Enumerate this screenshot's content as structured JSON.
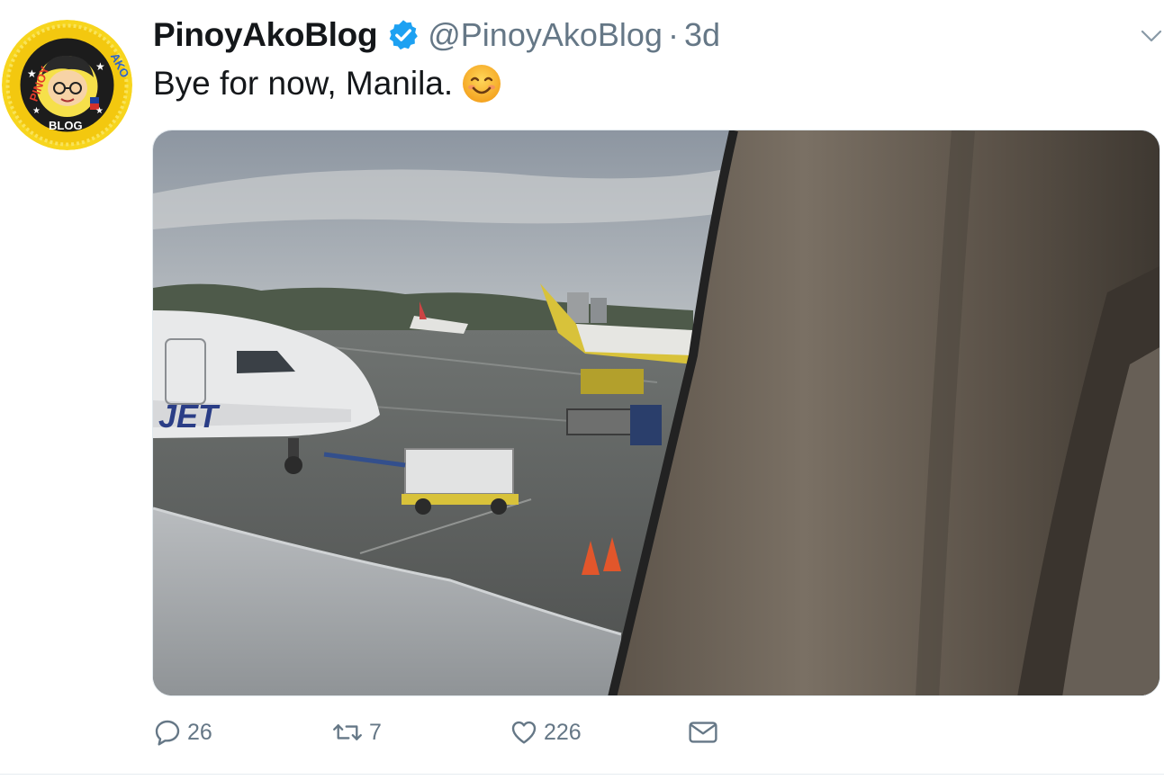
{
  "tweet": {
    "display_name": "PinoyAkoBlog",
    "handle": "@PinoyAkoBlog",
    "separator": "·",
    "timestamp": "3d",
    "text": "Bye for now, Manila.",
    "emoji": "smiling-face-icon",
    "avatar": {
      "label_left": "PINOY",
      "label_right": "AKO",
      "label_bottom": "BLOG"
    },
    "media": {
      "fuselage_text": "JET",
      "description_icon": "airport-window-photo"
    },
    "actions": {
      "reply_count": "26",
      "retweet_count": "7",
      "like_count": "226"
    }
  },
  "colors": {
    "text_primary": "#14171a",
    "text_secondary": "#657786",
    "verified_blue": "#1da1f2",
    "avatar_ring": "#f5d417",
    "divider": "#e6ecf0"
  }
}
